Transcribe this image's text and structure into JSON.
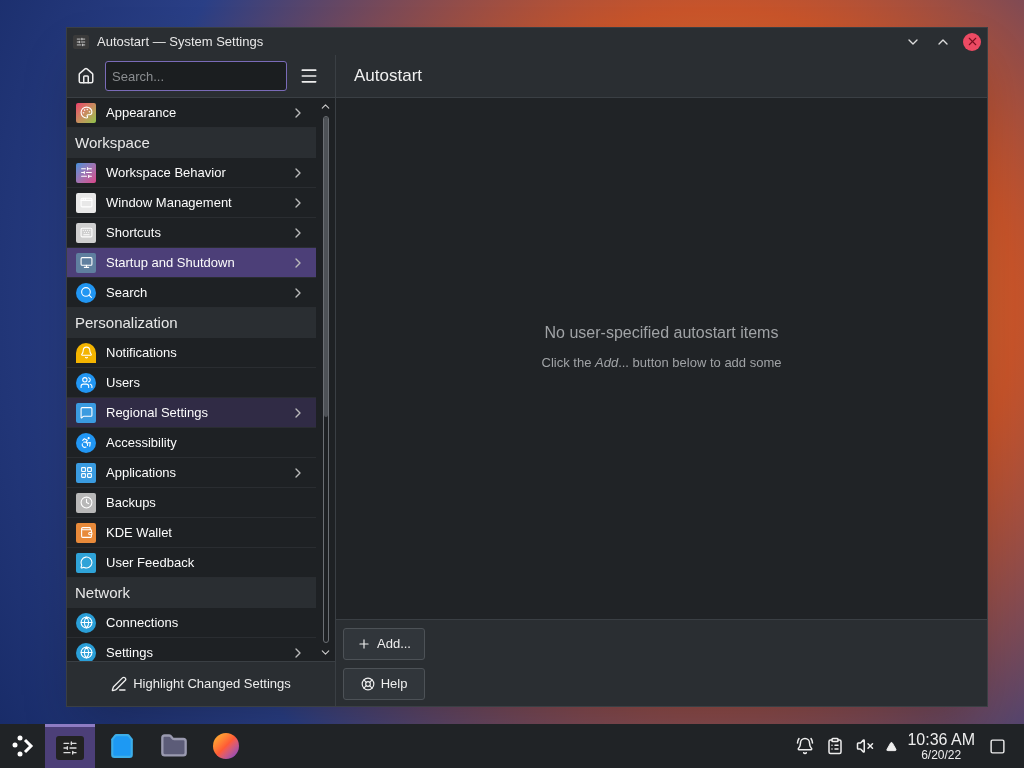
{
  "window": {
    "title": "Autostart — System Settings"
  },
  "sidebar": {
    "search": {
      "placeholder": "Search..."
    },
    "items": [
      {
        "kind": "item",
        "label": "Appearance",
        "expandable": true,
        "selected": false,
        "hovered": false
      },
      {
        "kind": "category",
        "label": "Workspace"
      },
      {
        "kind": "item",
        "label": "Workspace Behavior",
        "expandable": true,
        "selected": false,
        "hovered": false
      },
      {
        "kind": "item",
        "label": "Window Management",
        "expandable": true,
        "selected": false,
        "hovered": false
      },
      {
        "kind": "item",
        "label": "Shortcuts",
        "expandable": true,
        "selected": false,
        "hovered": false
      },
      {
        "kind": "item",
        "label": "Startup and Shutdown",
        "expandable": true,
        "selected": true,
        "hovered": false
      },
      {
        "kind": "item",
        "label": "Search",
        "expandable": true,
        "selected": false,
        "hovered": false
      },
      {
        "kind": "category",
        "label": "Personalization"
      },
      {
        "kind": "item",
        "label": "Notifications",
        "expandable": false,
        "selected": false,
        "hovered": false
      },
      {
        "kind": "item",
        "label": "Users",
        "expandable": false,
        "selected": false,
        "hovered": false
      },
      {
        "kind": "item",
        "label": "Regional Settings",
        "expandable": true,
        "selected": false,
        "hovered": true
      },
      {
        "kind": "item",
        "label": "Accessibility",
        "expandable": false,
        "selected": false,
        "hovered": false
      },
      {
        "kind": "item",
        "label": "Applications",
        "expandable": true,
        "selected": false,
        "hovered": false
      },
      {
        "kind": "item",
        "label": "Backups",
        "expandable": false,
        "selected": false,
        "hovered": false
      },
      {
        "kind": "item",
        "label": "KDE Wallet",
        "expandable": false,
        "selected": false,
        "hovered": false
      },
      {
        "kind": "item",
        "label": "User Feedback",
        "expandable": false,
        "selected": false,
        "hovered": false
      },
      {
        "kind": "category",
        "label": "Network"
      },
      {
        "kind": "item",
        "label": "Connections",
        "expandable": false,
        "selected": false,
        "hovered": false
      },
      {
        "kind": "item",
        "label": "Settings",
        "expandable": true,
        "selected": false,
        "hovered": false
      }
    ],
    "footer_button": "Highlight Changed Settings"
  },
  "page": {
    "title": "Autostart",
    "empty_title": "No user-specified autostart items",
    "empty_hint": "Click the *Add*... button below to add some",
    "buttons": [
      {
        "kind": "add",
        "label": "Add..."
      },
      {
        "kind": "help",
        "label": "Help"
      }
    ]
  },
  "taskbar": {
    "tasks": [
      {
        "kind": "settings",
        "selected": true
      },
      {
        "kind": "store",
        "selected": false
      },
      {
        "kind": "files",
        "selected": false
      },
      {
        "kind": "browser",
        "selected": false
      }
    ],
    "clock": {
      "time": "10:36 AM",
      "date": "6/20/22"
    }
  }
}
